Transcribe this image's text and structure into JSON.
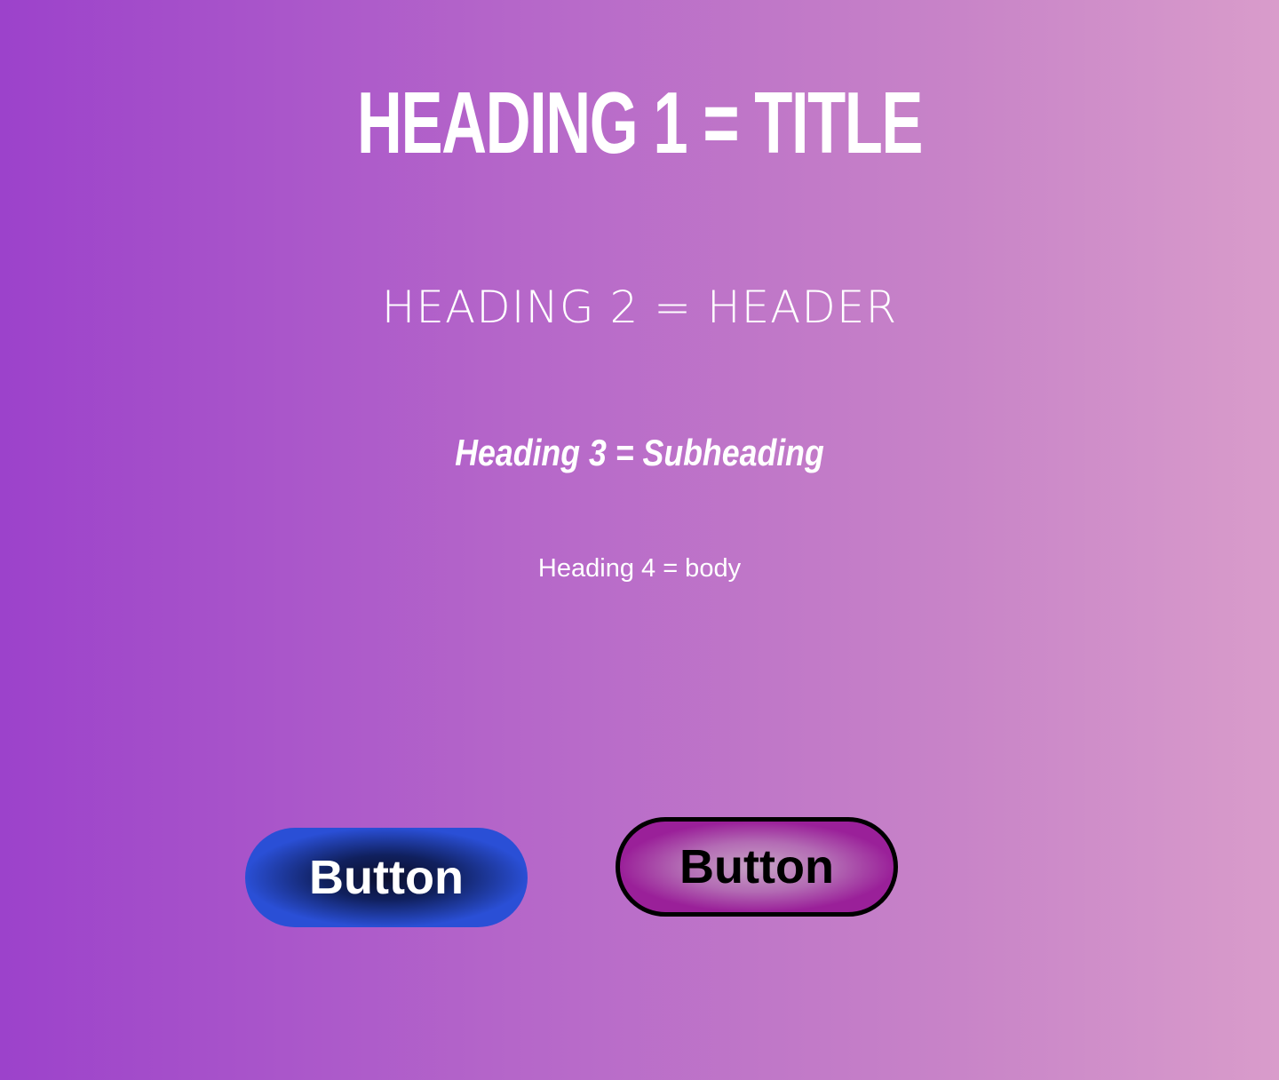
{
  "headings": {
    "h1": "HEADING 1 = TITLE",
    "h2": "HEADING 2 = HEADER",
    "h3": "Heading 3 = Subheading",
    "h4": "Heading 4 = body"
  },
  "buttons": {
    "primary_label": "Button",
    "secondary_label": "Button"
  },
  "colors": {
    "background_start": "#9c42cb",
    "background_end": "#d99ccb",
    "primary_button_edge": "#2a4fd6",
    "primary_button_center": "#0b0f2e",
    "secondary_button_edge": "#9a2099",
    "secondary_button_center": "#c8a3c6",
    "text": "#ffffff"
  }
}
